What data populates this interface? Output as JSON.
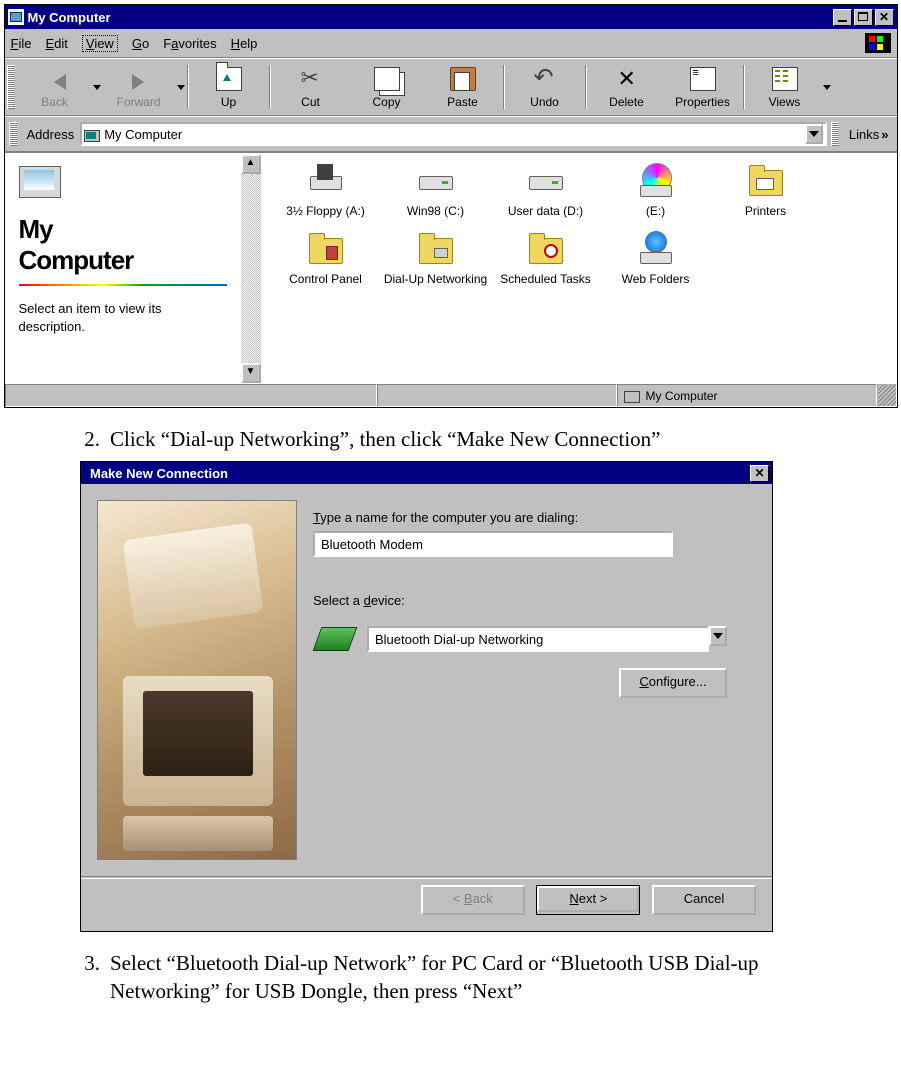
{
  "win1": {
    "title": "My Computer",
    "menu": {
      "file": "File",
      "edit": "Edit",
      "view": "View",
      "go": "Go",
      "fav": "Favorites",
      "help": "Help"
    },
    "toolbar": {
      "back": "Back",
      "forward": "Forward",
      "up": "Up",
      "cut": "Cut",
      "copy": "Copy",
      "paste": "Paste",
      "undo": "Undo",
      "delete": "Delete",
      "properties": "Properties",
      "views": "Views"
    },
    "address": {
      "label": "Address",
      "value": "My Computer",
      "links": "Links"
    },
    "infopane": {
      "heading": "My\nComputer",
      "heading1": "My",
      "heading2": "Computer",
      "desc": "Select an item to view its description."
    },
    "icons": {
      "floppy": "3½ Floppy (A:)",
      "win98": "Win98 (C:)",
      "userdata": "User data (D:)",
      "e": "(E:)",
      "printers": "Printers",
      "cp": "Control Panel",
      "dun": "Dial-Up Networking",
      "sched": "Scheduled Tasks",
      "webf": "Web Folders"
    },
    "status": {
      "zone": "My Computer"
    }
  },
  "step2": {
    "num": "2.",
    "text": "Click “Dial-up Networking”, then click  “Make New Connection”"
  },
  "win2": {
    "title": "Make New Connection",
    "typename_label": "Type a name for the computer you are dialing:",
    "name_value": "Bluetooth Modem",
    "device_label": "Select a device:",
    "device_value": "Bluetooth Dial-up Networking",
    "configure": "Configure...",
    "back": "< Back",
    "next": "Next >",
    "cancel": "Cancel"
  },
  "step3": {
    "num": "3.",
    "text": "Select “Bluetooth Dial-up Network” for PC Card or “Bluetooth USB Dial-up Networking” for USB Dongle, then press “Next”"
  }
}
